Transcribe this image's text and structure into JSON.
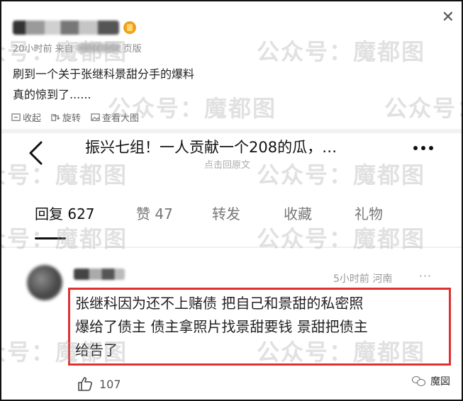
{
  "post": {
    "author_suffix": "",
    "meta_time": "20小时前",
    "meta_from": "来自",
    "meta_client_suffix": "页版",
    "text_line1": "刷到一个关于张继科景甜分手的爆料",
    "text_line2": "真的惊到了......",
    "actions": {
      "collect": "收起",
      "repost": "旋转",
      "view_large": "查看大图"
    }
  },
  "inner": {
    "title": "振兴七组！一人贡献一个208的瓜，…",
    "subtitle": "点击回原文",
    "tabs": [
      {
        "label": "回复",
        "count": "627"
      },
      {
        "label": "赞",
        "count": "47"
      },
      {
        "label": "转发",
        "count": ""
      },
      {
        "label": "收藏",
        "count": ""
      },
      {
        "label": "礼物",
        "count": ""
      }
    ]
  },
  "comment": {
    "meta": "5小时前 河南",
    "more": "···",
    "text_line1": "张继科因为还不上赌债 把自己和景甜的私密照",
    "text_line2": "爆给了债主 债主拿照片找景甜要钱 景甜把债主",
    "text_line3": "给告了",
    "likes": "107"
  },
  "footer": {
    "label": "魔図"
  },
  "watermark": {
    "text": "公众号：魔都图"
  },
  "colors": {
    "highlight_box": "#e03030",
    "watermark": "#aaaaaa"
  },
  "icons": [
    "close-icon",
    "back-arrow-icon",
    "more-icon",
    "like-icon",
    "wechat-icon",
    "collect-icon",
    "repost-icon",
    "image-icon"
  ]
}
